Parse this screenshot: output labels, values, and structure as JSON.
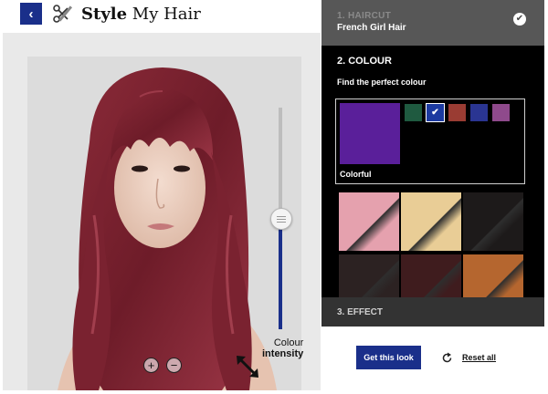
{
  "header": {
    "back_icon": "chevron-left-icon",
    "back_glyph": "‹",
    "tools_icon": "scissors-comb-icon",
    "title_bold": "Style",
    "title_rest": " My Hair"
  },
  "preview": {
    "intensity_label_line1": "Colour",
    "intensity_label_line2": "intensity",
    "intensity_level": 0.5,
    "zoom_in_glyph": "+",
    "zoom_out_glyph": "−",
    "resize_icon": "resize-arrows-icon"
  },
  "steps": {
    "haircut": {
      "label": "1. HAIRCUT",
      "value": "French Girl Hair",
      "check_glyph": "✔"
    },
    "colour": {
      "label": "2. COLOUR",
      "subtitle": "Find the perfect colour",
      "family": {
        "label": "Colorful",
        "color": "#5a1f9a"
      },
      "family_swatches": [
        {
          "color": "#1f5a40",
          "selected": false
        },
        {
          "color": "#1c3aa0",
          "selected": true
        },
        {
          "color": "#9a3c33",
          "selected": false
        },
        {
          "color": "#2a3592",
          "selected": false
        },
        {
          "color": "#8f4a8c",
          "selected": false
        }
      ],
      "selected_check": "✔",
      "shades": [
        {
          "color": "#e5a1ae"
        },
        {
          "color": "#e9cd96"
        },
        {
          "color": "#1d1a1a"
        },
        {
          "color": "#2c2222"
        },
        {
          "color": "#3f1c1e"
        },
        {
          "color": "#b5662f"
        }
      ]
    },
    "effect": {
      "label": "3. EFFECT"
    }
  },
  "actions": {
    "get_look": "Get this look",
    "reset": "Reset all",
    "reset_icon": "refresh-icon"
  },
  "colors": {
    "accent": "#1a2f8a",
    "hair": "#7c2230"
  }
}
